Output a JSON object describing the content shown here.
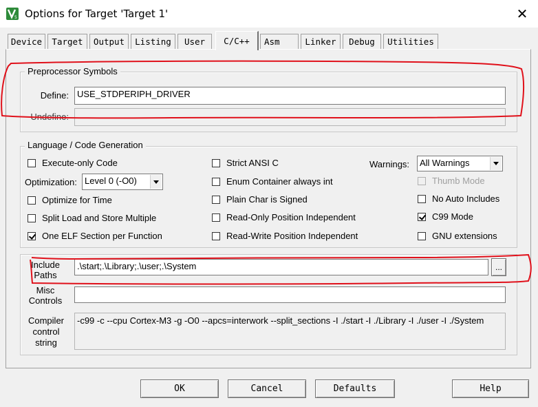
{
  "window": {
    "title": "Options for Target 'Target 1'",
    "close_glyph": "✕"
  },
  "tabs": [
    {
      "label": "Device"
    },
    {
      "label": "Target"
    },
    {
      "label": "Output"
    },
    {
      "label": "Listing"
    },
    {
      "label": "User"
    },
    {
      "label": "C/C++",
      "active": true
    },
    {
      "label": "Asm"
    },
    {
      "label": "Linker"
    },
    {
      "label": "Debug"
    },
    {
      "label": "Utilities"
    }
  ],
  "preprocessor": {
    "legend": "Preprocessor Symbols",
    "define_label": "Define:",
    "define_value": "USE_STDPERIPH_DRIVER",
    "undefine_label": "Undefine:",
    "undefine_value": ""
  },
  "language": {
    "legend": "Language / Code Generation",
    "execute_only": {
      "label": "Execute-only Code",
      "checked": false
    },
    "optimization_label": "Optimization:",
    "optimization_value": "Level 0 (-O0)",
    "optimize_time": {
      "label": "Optimize for Time",
      "checked": false
    },
    "split_load": {
      "label": "Split Load and Store Multiple",
      "checked": false
    },
    "one_elf": {
      "label": "One ELF Section per Function",
      "checked": true
    },
    "strict_ansi": {
      "label": "Strict ANSI C",
      "checked": false
    },
    "enum_container": {
      "label": "Enum Container always int",
      "checked": false
    },
    "plain_char": {
      "label": "Plain Char is Signed",
      "checked": false
    },
    "ro_pos_ind": {
      "label": "Read-Only Position Independent",
      "checked": false
    },
    "rw_pos_ind": {
      "label": "Read-Write Position Independent",
      "checked": false
    },
    "warnings_label": "Warnings:",
    "warnings_value": "All Warnings",
    "thumb_mode": {
      "label": "Thumb Mode",
      "checked": false,
      "disabled": true
    },
    "no_auto_includes": {
      "label": "No Auto Includes",
      "checked": false
    },
    "c99_mode": {
      "label": "C99 Mode",
      "checked": true
    },
    "gnu_extensions": {
      "label": "GNU extensions",
      "checked": false
    }
  },
  "include": {
    "label_line1": "Include",
    "label_line2": "Paths",
    "value": ".\\start;.\\Library;.\\user;.\\System",
    "browse_label": "..."
  },
  "misc": {
    "label_line1": "Misc",
    "label_line2": "Controls",
    "value": ""
  },
  "compiler": {
    "label_line1": "Compiler",
    "label_line2": "control",
    "label_line3": "string",
    "value": "-c99 -c --cpu Cortex-M3 -g -O0 --apcs=interwork --split_sections -I ./start -I ./Library -I ./user -I ./System"
  },
  "buttons": {
    "ok": "OK",
    "cancel": "Cancel",
    "defaults": "Defaults",
    "help": "Help"
  },
  "colors": {
    "annotation": "#e0101a",
    "dialog_bg": "#f0f0f0"
  }
}
